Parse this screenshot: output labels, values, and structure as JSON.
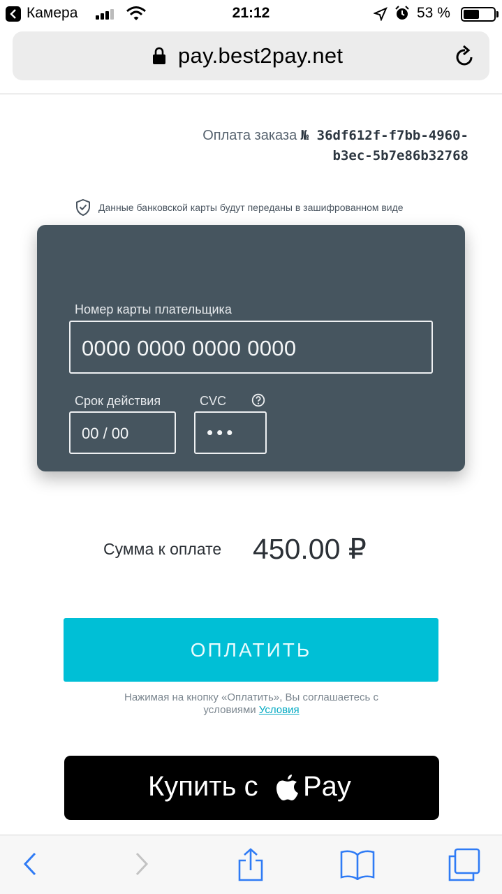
{
  "status_bar": {
    "app_label": "Камера",
    "time": "21:12",
    "battery": "53 %",
    "battery_level": 0.53,
    "icons": [
      "back-icon",
      "signal-icon",
      "wifi-icon",
      "location-icon",
      "alarm-icon",
      "battery-icon"
    ]
  },
  "address_bar": {
    "url": "pay.best2pay.net",
    "icons": [
      "lock-icon",
      "reload-icon"
    ]
  },
  "order": {
    "prefix": "Оплата заказа",
    "number": "№ 36df612f-f7bb-4960-b3ec-5b7e86b32768"
  },
  "secure_note": "Данные банковской карты будут переданы в зашифрованном виде",
  "card_form": {
    "card_number_label": "Номер карты плательщика",
    "card_number_placeholder": "0000 0000 0000 0000",
    "expiry_label": "Срок действия",
    "expiry_placeholder": "00 / 00",
    "cvc_label": "CVC",
    "cvc_placeholder": "•••"
  },
  "amount": {
    "label": "Сумма к оплате",
    "value": "450.00 ₽"
  },
  "pay_button": "ОПЛАТИТЬ",
  "terms": {
    "text": "Нажимая на кнопку «Оплатить», Вы соглашаетесь с условиями",
    "link": "Условия"
  },
  "apple_pay": {
    "buy_label": "Купить с",
    "pay_label": "Pay"
  },
  "colors": {
    "card_bg": "#46555f",
    "pay_button": "#00bfd6",
    "apple_button": "#000000"
  }
}
